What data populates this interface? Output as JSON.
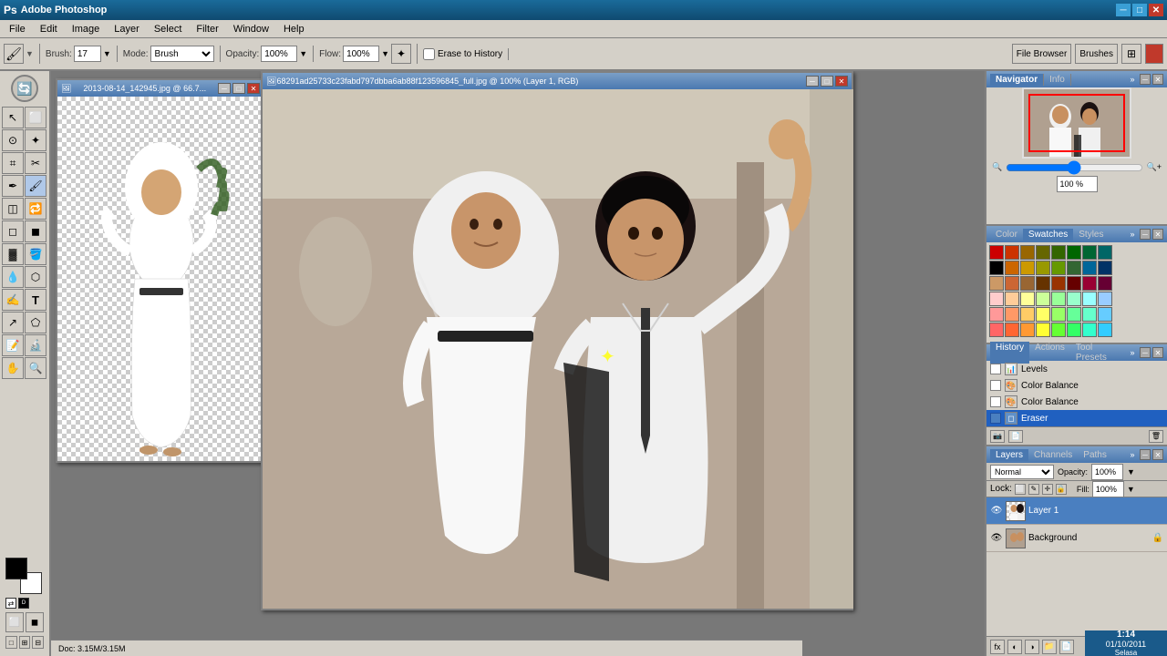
{
  "app": {
    "title": "Adobe Photoshop",
    "title_icon": "🅿"
  },
  "title_bar": {
    "minimize": "─",
    "maximize": "□",
    "close": "✕"
  },
  "menu": {
    "items": [
      "File",
      "Edit",
      "Image",
      "Layer",
      "Select",
      "Filter",
      "Window",
      "Help"
    ]
  },
  "toolbar": {
    "brush_label": "Brush:",
    "brush_size": "17",
    "mode_label": "Mode:",
    "mode_value": "Brush",
    "opacity_label": "Opacity:",
    "opacity_value": "100%",
    "flow_label": "Flow:",
    "flow_value": "100%",
    "erase_history_label": "Erase to History",
    "file_browser_label": "File Browser",
    "brushes_label": "Brushes"
  },
  "doc1": {
    "title": "2013-08-14_142945.jpg @ 66.7...",
    "canvas_hint": "small_image_transparent"
  },
  "doc2": {
    "title": "68291ad25733c23fabd797dbba6ab88f123596845_full.jpg @ 100% (Layer 1, RGB)",
    "canvas_hint": "main_image_couple"
  },
  "navigator": {
    "tab_active": "Navigator",
    "tab2": "Info",
    "zoom_percent": "100 %",
    "expand": "»"
  },
  "swatches": {
    "tab_active": "Swatches",
    "tab2": "Color",
    "tab3": "Styles",
    "colors": [
      "#cc0000",
      "#cc3300",
      "#996600",
      "#666600",
      "#336600",
      "#006600",
      "#006633",
      "#006666",
      "#000000",
      "#cc6600",
      "#cc9900",
      "#999900",
      "#669900",
      "#336633",
      "#006699",
      "#003366",
      "#cc9966",
      "#cc6633",
      "#996633",
      "#663300",
      "#993300",
      "#660000",
      "#990033",
      "#660033",
      "#ffcccc",
      "#ffcc99",
      "#ffff99",
      "#ccff99",
      "#99ff99",
      "#99ffcc",
      "#99ffff",
      "#99ccff",
      "#ff9999",
      "#ff9966",
      "#ffcc66",
      "#ffff66",
      "#99ff66",
      "#66ff99",
      "#66ffcc",
      "#66ccff",
      "#ff6666",
      "#ff6633",
      "#ff9933",
      "#ffff33",
      "#66ff33",
      "#33ff66",
      "#33ffcc",
      "#33ccff"
    ],
    "expand": "»"
  },
  "history": {
    "tab_active": "History",
    "tab2": "Actions",
    "tab3": "Tool Presets",
    "items": [
      {
        "name": "Levels",
        "active": false
      },
      {
        "name": "Color Balance",
        "active": false
      },
      {
        "name": "Color Balance",
        "active": false
      },
      {
        "name": "Eraser",
        "active": true
      }
    ],
    "expand": "»"
  },
  "layers": {
    "tab_active": "Layers",
    "tab2": "Channels",
    "tab3": "Paths",
    "blend_mode": "Normal",
    "opacity_label": "Opacity:",
    "opacity_value": "100%",
    "fill_label": "Fill:",
    "fill_value": "100%",
    "lock_label": "Lock:",
    "items": [
      {
        "name": "Layer 1",
        "visible": true,
        "active": true,
        "locked": false
      },
      {
        "name": "Background",
        "visible": true,
        "active": false,
        "locked": true
      }
    ],
    "expand": "»"
  },
  "status": {
    "time": "1:14",
    "date": "01/10/2011",
    "day": "Selasa"
  },
  "tools": [
    {
      "icon": "↖",
      "name": "move-tool"
    },
    {
      "icon": "⬜",
      "name": "marquee-tool"
    },
    {
      "icon": "⊙",
      "name": "lasso-tool"
    },
    {
      "icon": "✦",
      "name": "magic-wand-tool"
    },
    {
      "icon": "✂",
      "name": "crop-tool"
    },
    {
      "icon": "✒",
      "name": "healing-tool"
    },
    {
      "icon": "🖌",
      "name": "brush-tool"
    },
    {
      "icon": "◫",
      "name": "clone-tool"
    },
    {
      "icon": "🔍",
      "name": "history-brush-tool"
    },
    {
      "icon": "◻",
      "name": "eraser-tool"
    },
    {
      "icon": "▓",
      "name": "gradient-tool"
    },
    {
      "icon": "✎",
      "name": "blur-tool"
    },
    {
      "icon": "⬡",
      "name": "dodge-tool"
    },
    {
      "icon": "✍",
      "name": "pen-tool"
    },
    {
      "icon": "T",
      "name": "type-tool"
    },
    {
      "icon": "↗",
      "name": "path-selection-tool"
    },
    {
      "icon": "⬠",
      "name": "shape-tool"
    },
    {
      "icon": "☞",
      "name": "notes-tool"
    },
    {
      "icon": "👁",
      "name": "eyedropper-tool"
    },
    {
      "icon": "✋",
      "name": "hand-tool"
    },
    {
      "icon": "🔍",
      "name": "zoom-tool"
    }
  ]
}
